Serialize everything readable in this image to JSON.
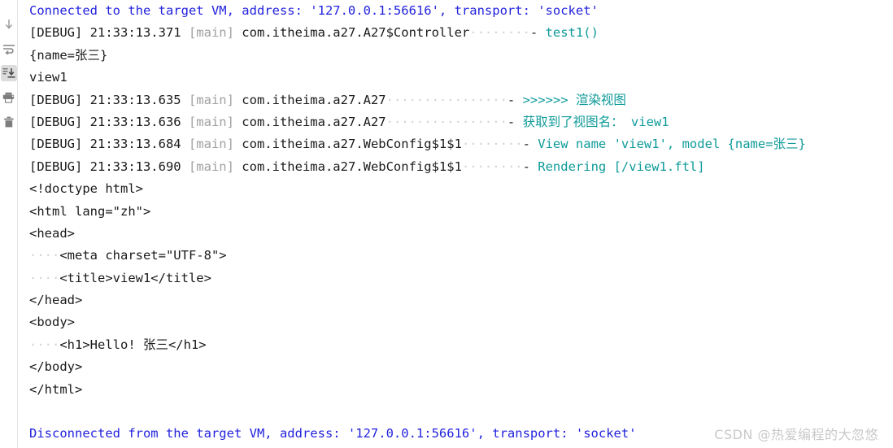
{
  "toolbar": {
    "items": [
      {
        "name": "scroll-to-end-icon",
        "label": "Scroll to End",
        "active": false
      },
      {
        "name": "soft-wrap-icon",
        "label": "Use Soft Wraps",
        "active": false
      },
      {
        "name": "export-to-file-icon",
        "label": "Export to Text File",
        "active": true
      },
      {
        "name": "print-icon",
        "label": "Print",
        "active": false
      },
      {
        "name": "trash-icon",
        "label": "Clear All",
        "active": false
      }
    ]
  },
  "console": {
    "lines": [
      {
        "id": "line-connected",
        "segments": [
          {
            "cls": "c-vm",
            "text": "Connected to the target VM, address: '127.0.0.1:56616', transport: 'socket'"
          }
        ]
      },
      {
        "id": "line-debug-371",
        "segments": [
          {
            "cls": "c-plain",
            "text": "[DEBUG] 21:33:13.371 "
          },
          {
            "cls": "c-thread",
            "text": "[main]"
          },
          {
            "cls": "c-plain",
            "text": " com.itheima.a27.A27$Controller"
          },
          {
            "cls": "c-dot",
            "text": "········"
          },
          {
            "cls": "c-plain",
            "text": "- "
          },
          {
            "cls": "c-msg",
            "text": "test1()"
          }
        ]
      },
      {
        "id": "line-name-zhangsan",
        "segments": [
          {
            "cls": "c-plain",
            "text": "{name=张三}"
          }
        ]
      },
      {
        "id": "line-view1",
        "segments": [
          {
            "cls": "c-plain",
            "text": "view1"
          }
        ]
      },
      {
        "id": "line-debug-635",
        "segments": [
          {
            "cls": "c-plain",
            "text": "[DEBUG] 21:33:13.635 "
          },
          {
            "cls": "c-thread",
            "text": "[main]"
          },
          {
            "cls": "c-plain",
            "text": " com.itheima.a27.A27"
          },
          {
            "cls": "c-dot",
            "text": "················"
          },
          {
            "cls": "c-plain",
            "text": "- "
          },
          {
            "cls": "c-msg",
            "text": ">>>>>> 渲染视图"
          }
        ]
      },
      {
        "id": "line-debug-636",
        "segments": [
          {
            "cls": "c-plain",
            "text": "[DEBUG] 21:33:13.636 "
          },
          {
            "cls": "c-thread",
            "text": "[main]"
          },
          {
            "cls": "c-plain",
            "text": " com.itheima.a27.A27"
          },
          {
            "cls": "c-dot",
            "text": "················"
          },
          {
            "cls": "c-plain",
            "text": "- "
          },
          {
            "cls": "c-msg",
            "text": "获取到了视图名： view1"
          }
        ]
      },
      {
        "id": "line-debug-684",
        "segments": [
          {
            "cls": "c-plain",
            "text": "[DEBUG] 21:33:13.684 "
          },
          {
            "cls": "c-thread",
            "text": "[main]"
          },
          {
            "cls": "c-plain",
            "text": " com.itheima.a27.WebConfig$1$1"
          },
          {
            "cls": "c-dot",
            "text": "········"
          },
          {
            "cls": "c-plain",
            "text": "- "
          },
          {
            "cls": "c-msg",
            "text": "View name 'view1', model {name=张三}"
          }
        ]
      },
      {
        "id": "line-debug-690",
        "segments": [
          {
            "cls": "c-plain",
            "text": "[DEBUG] 21:33:13.690 "
          },
          {
            "cls": "c-thread",
            "text": "[main]"
          },
          {
            "cls": "c-plain",
            "text": " com.itheima.a27.WebConfig$1$1"
          },
          {
            "cls": "c-dot",
            "text": "········"
          },
          {
            "cls": "c-plain",
            "text": "- "
          },
          {
            "cls": "c-msg",
            "text": "Rendering [/view1.ftl]"
          }
        ]
      },
      {
        "id": "line-doctype",
        "segments": [
          {
            "cls": "c-plain",
            "text": "<!doctype html>"
          }
        ]
      },
      {
        "id": "line-html-open",
        "segments": [
          {
            "cls": "c-plain",
            "text": "<html lang=\"zh\">"
          }
        ]
      },
      {
        "id": "line-head-open",
        "segments": [
          {
            "cls": "c-plain",
            "text": "<head>"
          }
        ]
      },
      {
        "id": "line-meta-charset",
        "segments": [
          {
            "cls": "c-dot",
            "text": "····"
          },
          {
            "cls": "c-plain",
            "text": "<meta charset=\"UTF-8\">"
          }
        ]
      },
      {
        "id": "line-title",
        "segments": [
          {
            "cls": "c-dot",
            "text": "····"
          },
          {
            "cls": "c-plain",
            "text": "<title>view1</title>"
          }
        ]
      },
      {
        "id": "line-head-close",
        "segments": [
          {
            "cls": "c-plain",
            "text": "</head>"
          }
        ]
      },
      {
        "id": "line-body-open",
        "segments": [
          {
            "cls": "c-plain",
            "text": "<body>"
          }
        ]
      },
      {
        "id": "line-h1-hello",
        "segments": [
          {
            "cls": "c-dot",
            "text": "····"
          },
          {
            "cls": "c-plain",
            "text": "<h1>Hello! 张三</h1>"
          }
        ]
      },
      {
        "id": "line-body-close",
        "segments": [
          {
            "cls": "c-plain",
            "text": "</body>"
          }
        ]
      },
      {
        "id": "line-html-close",
        "segments": [
          {
            "cls": "c-plain",
            "text": "</html>"
          }
        ]
      },
      {
        "id": "line-blank",
        "segments": [
          {
            "cls": "c-plain",
            "text": " "
          }
        ]
      },
      {
        "id": "line-disconnected",
        "segments": [
          {
            "cls": "c-vm",
            "text": "Disconnected from the target VM, address: '127.0.0.1:56616', transport: 'socket'"
          }
        ]
      }
    ]
  },
  "watermark": {
    "text": "CSDN @热爱编程的大忽悠"
  },
  "colors": {
    "vm_message": "#2222dd",
    "log_text": "#1a1a1a",
    "thread_name": "#a0a0a0",
    "logger_message": "#0f9a9a",
    "whitespace_dot": "#d2d2d2",
    "watermark": "#c9c9c9",
    "background": "#ffffff",
    "toolbar_active_bg": "#dcdcdc"
  }
}
